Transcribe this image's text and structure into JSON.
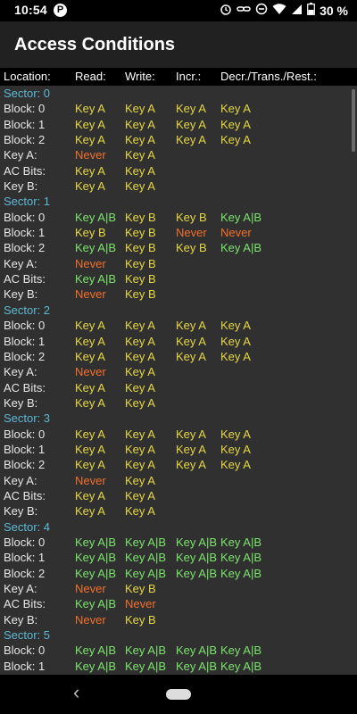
{
  "status_bar": {
    "time": "10:54",
    "app_icon_letter": "P",
    "battery": "30 %",
    "icons": [
      "alarm-icon",
      "link-icon",
      "dnd-icon",
      "wifi-icon",
      "signal-icon",
      "battery-icon"
    ]
  },
  "app": {
    "title": "Access Conditions"
  },
  "header": {
    "location": "Location:",
    "read": "Read:",
    "write": "Write:",
    "incr": "Incr.:",
    "decr": "Decr./Trans./Rest.:"
  },
  "rows": [
    {
      "type": "sector",
      "label": "Sector: 0"
    },
    {
      "type": "data",
      "cells": [
        "Block: 0",
        "Key A",
        "Key A",
        "Key A",
        "Key A"
      ],
      "colors": [
        "",
        "yellow",
        "yellow",
        "yellow",
        "yellow"
      ]
    },
    {
      "type": "data",
      "cells": [
        "Block: 1",
        "Key A",
        "Key A",
        "Key A",
        "Key A"
      ],
      "colors": [
        "",
        "yellow",
        "yellow",
        "yellow",
        "yellow"
      ]
    },
    {
      "type": "data",
      "cells": [
        "Block: 2",
        "Key A",
        "Key A",
        "Key A",
        "Key A"
      ],
      "colors": [
        "",
        "yellow",
        "yellow",
        "yellow",
        "yellow"
      ]
    },
    {
      "type": "data",
      "cells": [
        "Key A:",
        "Never",
        "Key A",
        "",
        ""
      ],
      "colors": [
        "",
        "orange",
        "yellow",
        "",
        ""
      ]
    },
    {
      "type": "data",
      "cells": [
        "AC Bits:",
        "Key A",
        "Key A",
        "",
        ""
      ],
      "colors": [
        "",
        "yellow",
        "yellow",
        "",
        ""
      ]
    },
    {
      "type": "data",
      "cells": [
        "Key B:",
        "Key A",
        "Key A",
        "",
        ""
      ],
      "colors": [
        "",
        "yellow",
        "yellow",
        "",
        ""
      ]
    },
    {
      "type": "sector",
      "label": "Sector: 1"
    },
    {
      "type": "data",
      "cells": [
        "Block: 0",
        "Key A|B",
        "Key B",
        "Key B",
        "Key A|B"
      ],
      "colors": [
        "",
        "green",
        "yellow",
        "yellow",
        "green"
      ]
    },
    {
      "type": "data",
      "cells": [
        "Block: 1",
        "Key B",
        "Key B",
        "Never",
        "Never"
      ],
      "colors": [
        "",
        "yellow",
        "yellow",
        "orange",
        "orange"
      ]
    },
    {
      "type": "data",
      "cells": [
        "Block: 2",
        "Key A|B",
        "Key B",
        "Key B",
        "Key A|B"
      ],
      "colors": [
        "",
        "green",
        "yellow",
        "yellow",
        "green"
      ]
    },
    {
      "type": "data",
      "cells": [
        "Key A:",
        "Never",
        "Key B",
        "",
        ""
      ],
      "colors": [
        "",
        "orange",
        "yellow",
        "",
        ""
      ]
    },
    {
      "type": "data",
      "cells": [
        "AC Bits:",
        "Key A|B",
        "Key B",
        "",
        ""
      ],
      "colors": [
        "",
        "green",
        "yellow",
        "",
        ""
      ]
    },
    {
      "type": "data",
      "cells": [
        "Key B:",
        "Never",
        "Key B",
        "",
        ""
      ],
      "colors": [
        "",
        "orange",
        "yellow",
        "",
        ""
      ]
    },
    {
      "type": "sector",
      "label": "Sector: 2"
    },
    {
      "type": "data",
      "cells": [
        "Block: 0",
        "Key A",
        "Key A",
        "Key A",
        "Key A"
      ],
      "colors": [
        "",
        "yellow",
        "yellow",
        "yellow",
        "yellow"
      ]
    },
    {
      "type": "data",
      "cells": [
        "Block: 1",
        "Key A",
        "Key A",
        "Key A",
        "Key A"
      ],
      "colors": [
        "",
        "yellow",
        "yellow",
        "yellow",
        "yellow"
      ]
    },
    {
      "type": "data",
      "cells": [
        "Block: 2",
        "Key A",
        "Key A",
        "Key A",
        "Key A"
      ],
      "colors": [
        "",
        "yellow",
        "yellow",
        "yellow",
        "yellow"
      ]
    },
    {
      "type": "data",
      "cells": [
        "Key A:",
        "Never",
        "Key A",
        "",
        ""
      ],
      "colors": [
        "",
        "orange",
        "yellow",
        "",
        ""
      ]
    },
    {
      "type": "data",
      "cells": [
        "AC Bits:",
        "Key A",
        "Key A",
        "",
        ""
      ],
      "colors": [
        "",
        "yellow",
        "yellow",
        "",
        ""
      ]
    },
    {
      "type": "data",
      "cells": [
        "Key B:",
        "Key A",
        "Key A",
        "",
        ""
      ],
      "colors": [
        "",
        "yellow",
        "yellow",
        "",
        ""
      ]
    },
    {
      "type": "sector",
      "label": "Sector: 3"
    },
    {
      "type": "data",
      "cells": [
        "Block: 0",
        "Key A",
        "Key A",
        "Key A",
        "Key A"
      ],
      "colors": [
        "",
        "yellow",
        "yellow",
        "yellow",
        "yellow"
      ]
    },
    {
      "type": "data",
      "cells": [
        "Block: 1",
        "Key A",
        "Key A",
        "Key A",
        "Key A"
      ],
      "colors": [
        "",
        "yellow",
        "yellow",
        "yellow",
        "yellow"
      ]
    },
    {
      "type": "data",
      "cells": [
        "Block: 2",
        "Key A",
        "Key A",
        "Key A",
        "Key A"
      ],
      "colors": [
        "",
        "yellow",
        "yellow",
        "yellow",
        "yellow"
      ]
    },
    {
      "type": "data",
      "cells": [
        "Key A:",
        "Never",
        "Key A",
        "",
        ""
      ],
      "colors": [
        "",
        "orange",
        "yellow",
        "",
        ""
      ]
    },
    {
      "type": "data",
      "cells": [
        "AC Bits:",
        "Key A",
        "Key A",
        "",
        ""
      ],
      "colors": [
        "",
        "yellow",
        "yellow",
        "",
        ""
      ]
    },
    {
      "type": "data",
      "cells": [
        "Key B:",
        "Key A",
        "Key A",
        "",
        ""
      ],
      "colors": [
        "",
        "yellow",
        "yellow",
        "",
        ""
      ]
    },
    {
      "type": "sector",
      "label": "Sector: 4"
    },
    {
      "type": "data",
      "cells": [
        "Block: 0",
        "Key A|B",
        "Key A|B",
        "Key A|B",
        "Key A|B"
      ],
      "colors": [
        "",
        "green",
        "green",
        "green",
        "green"
      ]
    },
    {
      "type": "data",
      "cells": [
        "Block: 1",
        "Key A|B",
        "Key A|B",
        "Key A|B",
        "Key A|B"
      ],
      "colors": [
        "",
        "green",
        "green",
        "green",
        "green"
      ]
    },
    {
      "type": "data",
      "cells": [
        "Block: 2",
        "Key A|B",
        "Key A|B",
        "Key A|B",
        "Key A|B"
      ],
      "colors": [
        "",
        "green",
        "green",
        "green",
        "green"
      ]
    },
    {
      "type": "data",
      "cells": [
        "Key A:",
        "Never",
        "Key B",
        "",
        ""
      ],
      "colors": [
        "",
        "orange",
        "yellow",
        "",
        ""
      ]
    },
    {
      "type": "data",
      "cells": [
        "AC Bits:",
        "Key A|B",
        "Never",
        "",
        ""
      ],
      "colors": [
        "",
        "green",
        "orange",
        "",
        ""
      ]
    },
    {
      "type": "data",
      "cells": [
        "Key B:",
        "Never",
        "Key B",
        "",
        ""
      ],
      "colors": [
        "",
        "orange",
        "yellow",
        "",
        ""
      ]
    },
    {
      "type": "sector",
      "label": "Sector: 5"
    },
    {
      "type": "data",
      "cells": [
        "Block: 0",
        "Key A|B",
        "Key A|B",
        "Key A|B",
        "Key A|B"
      ],
      "colors": [
        "",
        "green",
        "green",
        "green",
        "green"
      ]
    },
    {
      "type": "data",
      "cells": [
        "Block: 1",
        "Key A|B",
        "Key A|B",
        "Key A|B",
        "Key A|B"
      ],
      "colors": [
        "",
        "green",
        "green",
        "green",
        "green"
      ]
    }
  ],
  "colors": {
    "yellow": "#e5d744",
    "orange": "#f36f2c",
    "green": "#7be36c",
    "sector": "#5db9d2"
  },
  "nav": {
    "back_icon": "back-icon",
    "home_icon": "home-pill-icon"
  }
}
